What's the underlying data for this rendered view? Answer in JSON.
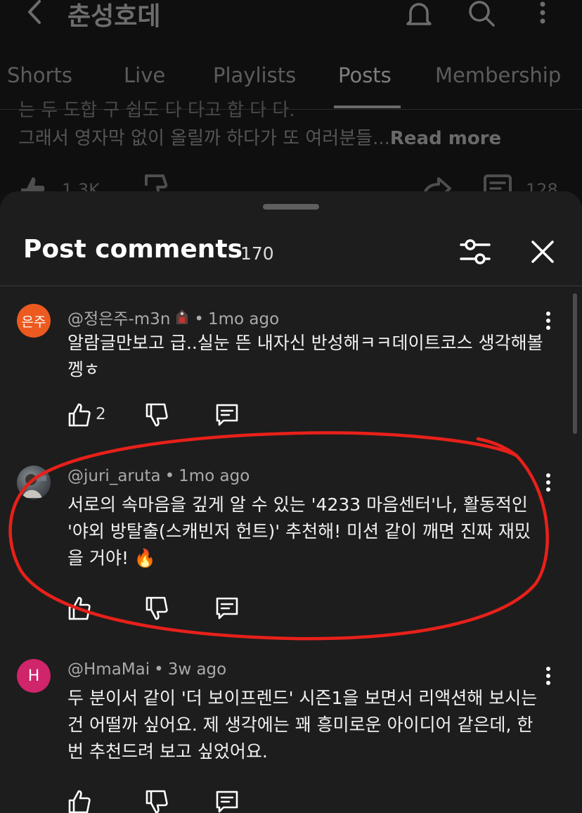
{
  "header": {
    "channel_name": "춘성호데"
  },
  "tabs": [
    {
      "label": "Shorts",
      "active": false
    },
    {
      "label": "Live",
      "active": false
    },
    {
      "label": "Playlists",
      "active": false
    },
    {
      "label": "Posts",
      "active": true
    },
    {
      "label": "Membership",
      "active": false
    }
  ],
  "post": {
    "partial_line": "는 두 도합 구 쉽도 다 다고 합 다 다.",
    "text_line": "그래서 영자막 없이 올릴까 하다가 또 여러분들...",
    "read_more": "Read more",
    "likes": "1.3K",
    "comments": "128"
  },
  "sheet": {
    "title": "Post comments",
    "count": "170"
  },
  "comments": [
    {
      "avatar_text": "은주",
      "author": "@정은주-m3n",
      "time": "1mo ago",
      "text": "알람글만보고 급..실눈 뜬 내자신 반성해ㅋㅋ데이트코스 생각해볼껭ㅎ",
      "likes": "2"
    },
    {
      "author": "@juri_aruta",
      "time": "1mo ago",
      "text": "서로의 속마음을 깊게 알 수 있는 '4233 마음센터'나, 활동적인 '야외 방탈출(스캐빈저 헌트)' 추천해! 미션 같이 깨면 진짜 재밌을 거야! 🔥",
      "likes": ""
    },
    {
      "avatar_text": "H",
      "author": "@HmaMai",
      "time": "3w ago",
      "text": "두 분이서 같이 '더 보이프렌드' 시즌1을 보면서 리액션해 보시는 건 어떨까 싶어요. 제 생각에는 꽤 흥미로운 아이디어 같은데, 한번 추천드려 보고 싶었어요.",
      "likes": ""
    }
  ],
  "colors": {
    "sheet_bg": "#1d1d1d",
    "page_bg": "#0f0f0f",
    "annotation_red": "#e8201a",
    "avatar_orange": "#ec5a1f",
    "avatar_pink": "#d0246b"
  }
}
